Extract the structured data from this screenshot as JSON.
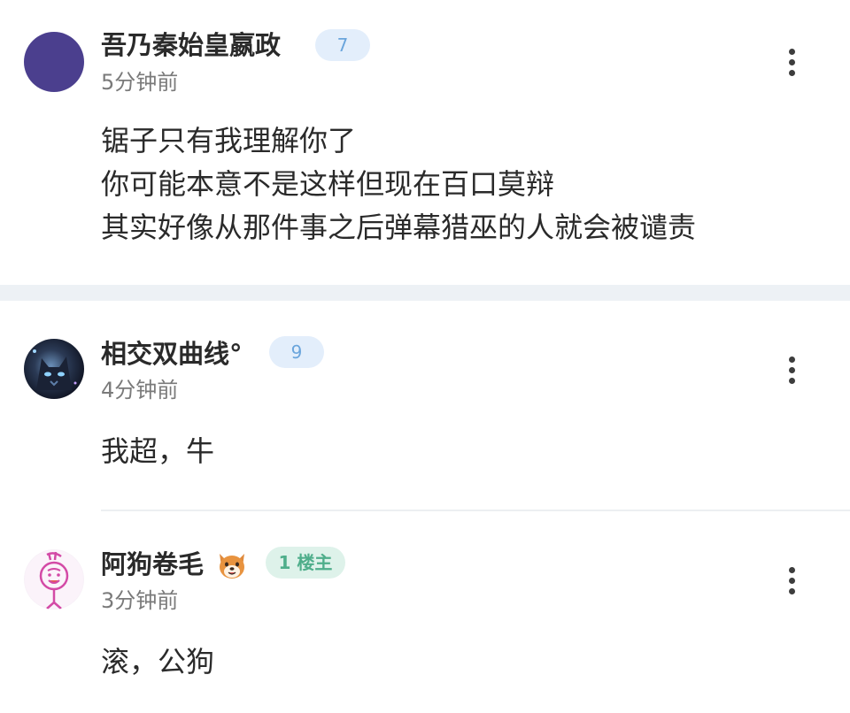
{
  "comments": [
    {
      "username": "吾乃秦始皇嬴政",
      "level": "7",
      "time": "5分钟前",
      "lines": [
        "锯子只有我理解你了",
        "你可能本意不是这样但现在百口莫辩",
        "其实好像从那件事之后弹幕猎巫的人就会被谴责"
      ],
      "avatar_color": "#4b3f8e"
    },
    {
      "username": "相交双曲线°",
      "level": "9",
      "time": "4分钟前",
      "lines": [
        "我超，牛"
      ],
      "avatar_icon": "dark-cat-portrait-icon"
    },
    {
      "username": "阿狗卷毛",
      "username_emoji": "shiba-dog-face-emoji",
      "badge": "1 楼主",
      "time": "3分钟前",
      "lines": [
        "滚，公狗"
      ],
      "avatar_icon": "stick-figure-doodle-icon"
    }
  ],
  "colors": {
    "level_badge_bg": "#e3eefb",
    "level_badge_text": "#6aa5dc",
    "op_badge_bg": "#def2ea",
    "op_badge_text": "#4fae8b",
    "section_divider": "#edf1f5"
  }
}
